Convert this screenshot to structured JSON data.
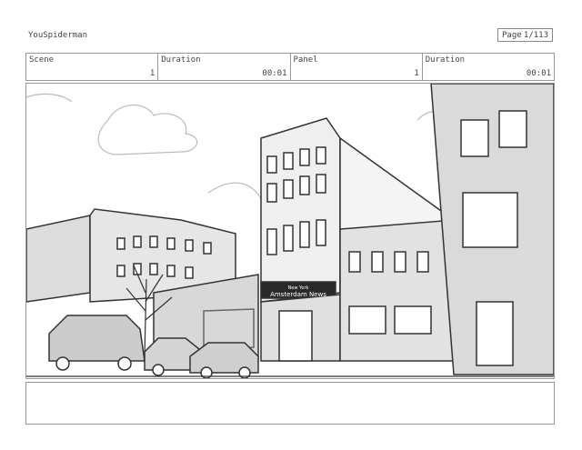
{
  "header": {
    "project_title": "YouSpiderman",
    "page_label": "Page",
    "page_value": "1/113"
  },
  "info": {
    "scene_label": "Scene",
    "scene_value": "1",
    "duration_label": "Duration",
    "duration_value": "00:01",
    "panel_label": "Panel",
    "panel_value": "1",
    "duration2_label": "Duration",
    "duration2_value": "00:01"
  },
  "panel": {
    "sign_line1": "New York",
    "sign_line2": "Amsterdam News"
  },
  "notes": {}
}
